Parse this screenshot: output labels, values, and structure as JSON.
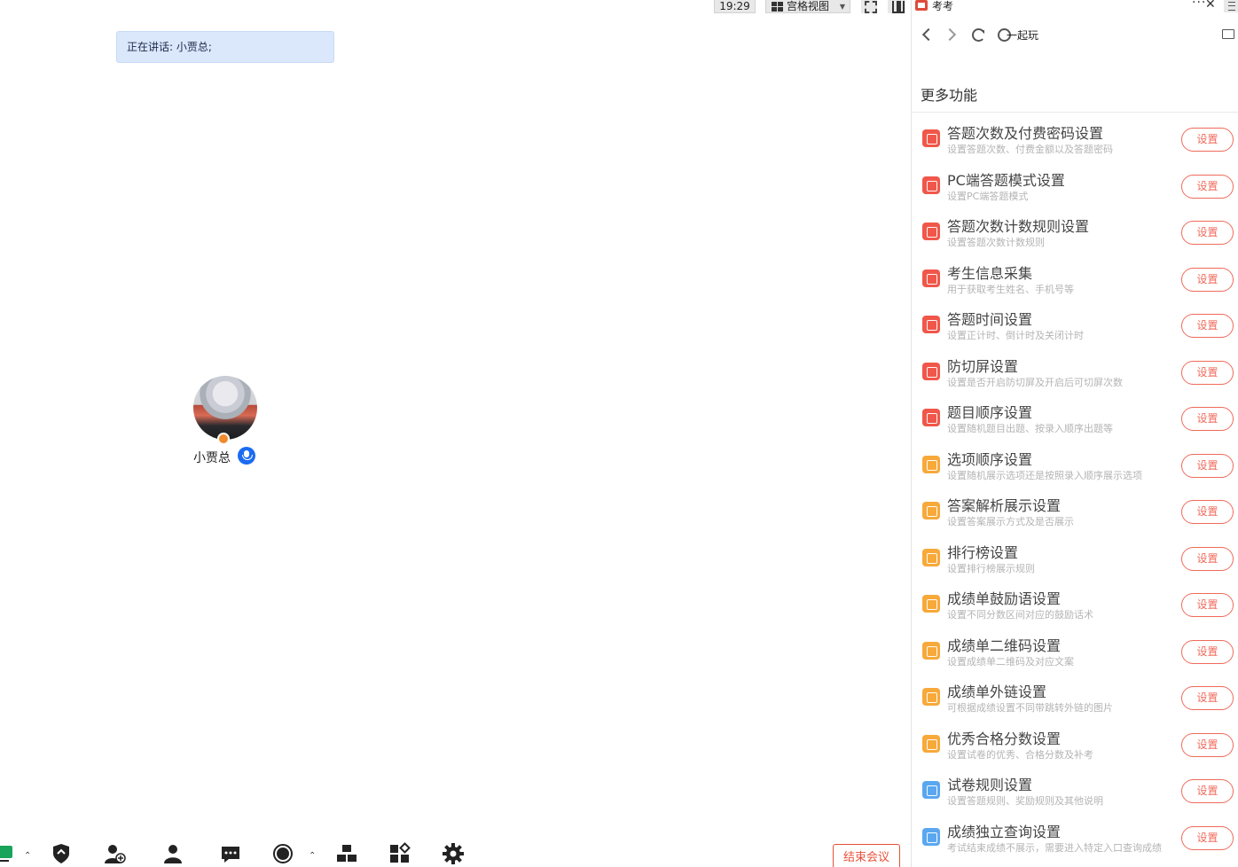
{
  "meeting": {
    "clock": "19:29",
    "view_label": "宫格视图",
    "speaking": "正在讲话: 小贾总;",
    "participant_name": "小贾总",
    "end_button": "结束会议",
    "toolbar_icons": [
      "screen-share-icon",
      "security-icon",
      "invite-icon",
      "participants-icon",
      "chat-icon",
      "record-icon",
      "breakout-icon",
      "apps-icon",
      "settings-icon"
    ]
  },
  "panel": {
    "app_name": "考考",
    "nav_play_label": "一起玩",
    "section_title": "更多功能",
    "items": [
      {
        "title": "答题次数及付费密码设置",
        "desc": "设置答题次数、付费金额以及答题密码",
        "button": "设置",
        "color": "#f0574a"
      },
      {
        "title": "PC端答题模式设置",
        "desc": "设置PC端答题模式",
        "button": "设置",
        "color": "#f0574a"
      },
      {
        "title": "答题次数计数规则设置",
        "desc": "设置答题次数计数规则",
        "button": "设置",
        "color": "#f0574a"
      },
      {
        "title": "考生信息采集",
        "desc": "用于获取考生姓名、手机号等",
        "button": "设置",
        "color": "#f0574a"
      },
      {
        "title": "答题时间设置",
        "desc": "设置正计时、倒计时及关闭计时",
        "button": "设置",
        "color": "#f0574a"
      },
      {
        "title": "防切屏设置",
        "desc": "设置是否开启防切屏及开启后可切屏次数",
        "button": "设置",
        "color": "#f0574a"
      },
      {
        "title": "题目顺序设置",
        "desc": "设置随机题目出题、按录入顺序出题等",
        "button": "设置",
        "color": "#f0574a"
      },
      {
        "title": "选项顺序设置",
        "desc": "设置随机展示选项还是按照录入顺序展示选项",
        "button": "设置",
        "color": "#f7a93a"
      },
      {
        "title": "答案解析展示设置",
        "desc": "设置答案展示方式及是否展示",
        "button": "设置",
        "color": "#f7a93a"
      },
      {
        "title": "排行榜设置",
        "desc": "设置排行榜展示规则",
        "button": "设置",
        "color": "#f7a93a"
      },
      {
        "title": "成绩单鼓励语设置",
        "desc": "设置不同分数区间对应的鼓励话术",
        "button": "设置",
        "color": "#f7a93a"
      },
      {
        "title": "成绩单二维码设置",
        "desc": "设置成绩单二维码及对应文案",
        "button": "设置",
        "color": "#f7a93a"
      },
      {
        "title": "成绩单外链设置",
        "desc": "可根据成绩设置不同带跳转外链的图片",
        "button": "设置",
        "color": "#f7a93a"
      },
      {
        "title": "优秀合格分数设置",
        "desc": "设置试卷的优秀、合格分数及补考",
        "button": "设置",
        "color": "#f7a93a"
      },
      {
        "title": "试卷规则设置",
        "desc": "设置答题规则、奖励规则及其他说明",
        "button": "设置",
        "color": "#5aa7f0"
      },
      {
        "title": "成绩独立查询设置",
        "desc": "考试结束成绩不展示，需要进入特定入口查询成绩",
        "button": "设置",
        "color": "#5aa7f0"
      }
    ]
  }
}
